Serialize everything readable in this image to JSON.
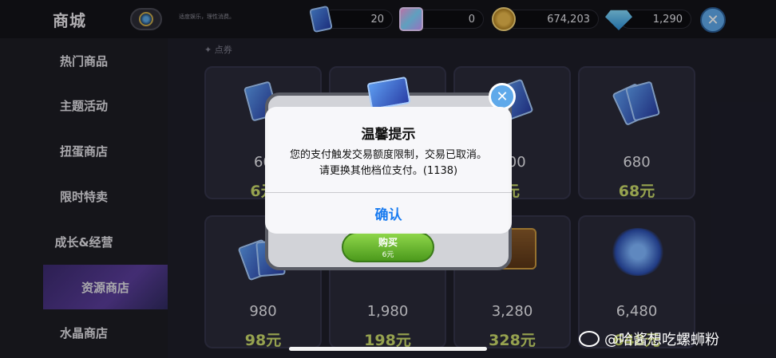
{
  "header": {
    "title": "商城",
    "notice": "适度娱乐，理性消费。",
    "currencies": [
      {
        "icon": "ticket-icon",
        "amount": "20"
      },
      {
        "icon": "cube-icon",
        "amount": "0"
      },
      {
        "icon": "coin-icon",
        "amount": "674,203"
      },
      {
        "icon": "gem-icon",
        "amount": "1,290"
      }
    ],
    "close_icon": "close-icon"
  },
  "sidebar": {
    "items": [
      {
        "label": "热门商品"
      },
      {
        "label": "主题活动"
      },
      {
        "label": "扭蛋商店"
      },
      {
        "label": "限时特卖"
      },
      {
        "label": "成长&经营"
      },
      {
        "label": "资源商店",
        "active": true
      },
      {
        "label": "水晶商店"
      }
    ]
  },
  "main": {
    "section_label": "✦ 点券",
    "cards": [
      {
        "qty": "60",
        "price": "6元"
      },
      {
        "qty": "",
        "price": ""
      },
      {
        "qty": "300",
        "price": "元"
      },
      {
        "qty": "680",
        "price": "68元"
      },
      {
        "qty": "980",
        "price": "98元"
      },
      {
        "qty": "1,980",
        "price": "198元"
      },
      {
        "qty": "3,280",
        "price": "328元"
      },
      {
        "qty": "6,480",
        "price": "648元"
      }
    ]
  },
  "purchase_dialog": {
    "buy_label": "购买",
    "buy_price": "6元"
  },
  "alert": {
    "title": "温馨提示",
    "message": "您的支付触发交易额度限制，交易已取消。请更换其他档位支付。(1138)",
    "confirm": "确认"
  },
  "watermark": "@哈酱想吃螺蛳粉"
}
